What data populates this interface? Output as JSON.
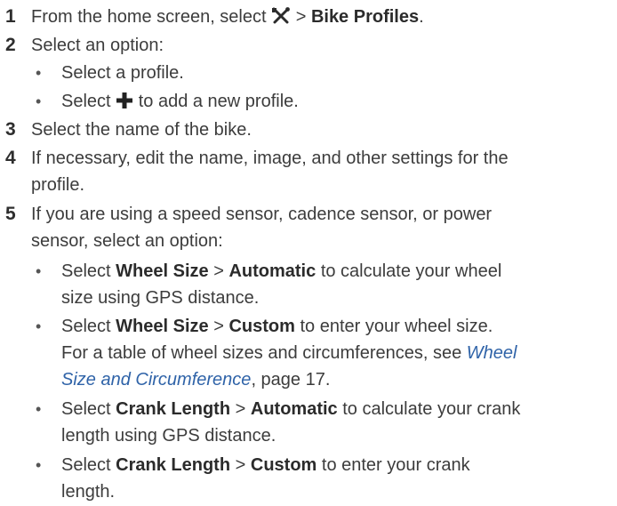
{
  "steps": [
    {
      "num": "1",
      "pre": "From the home screen, select",
      "icon": "wrench-screwdriver-icon",
      "sep": ">",
      "bold": "Bike Profiles",
      "post": "."
    },
    {
      "num": "2",
      "text": "Select an option:",
      "subs": [
        {
          "text": "Select a profile."
        },
        {
          "pre": "Select",
          "icon": "plus-icon",
          "post": "to add a new profile."
        }
      ]
    },
    {
      "num": "3",
      "text": "Select the name of the bike."
    },
    {
      "num": "4",
      "line1": "If necessary, edit the name, image, and other settings for the",
      "line2": "profile."
    },
    {
      "num": "5",
      "line1": "If you are using a speed sensor, cadence sensor, or power",
      "line2": "sensor, select an option:",
      "subs": [
        {
          "pre": "Select",
          "b1": "Wheel Size",
          "sep": ">",
          "b2": "Automatic",
          "post": "to calculate your wheel",
          "line2": "size using GPS distance."
        },
        {
          "pre": "Select",
          "b1": "Wheel Size",
          "sep": ">",
          "b2": "Custom",
          "post": "to enter your wheel size.",
          "line2": "For a table of wheel sizes and circumferences, see",
          "link1": "Wheel",
          "link2": "Size and Circumference",
          "ref": ", page 17."
        },
        {
          "pre": "Select",
          "b1": "Crank Length",
          "sep": ">",
          "b2": "Automatic",
          "post": "to calculate your crank",
          "line2": "length using GPS distance."
        },
        {
          "pre": "Select",
          "b1": "Crank Length",
          "sep": ">",
          "b2": "Custom",
          "post": "to enter your crank",
          "line2": "length."
        }
      ]
    }
  ],
  "bullet_char": "•",
  "colors": {
    "text": "#3c3c3c",
    "link": "#2f63a8"
  }
}
